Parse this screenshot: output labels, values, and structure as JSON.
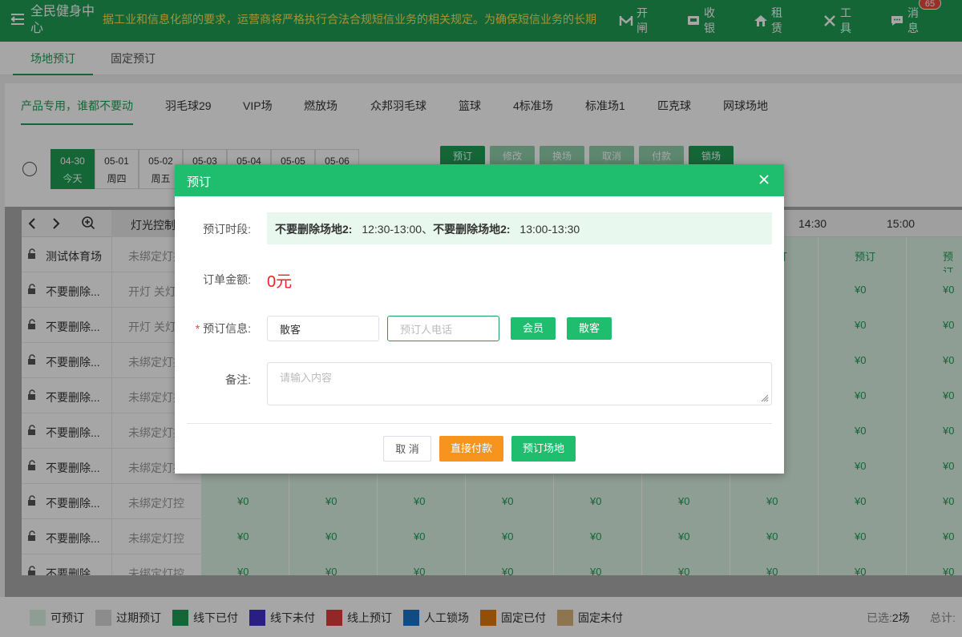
{
  "app": {
    "title": "全民健身中心",
    "notice": "据工业和信息化部的要求，运营商将严格执行合法合规短信业务的相关规定。为确保短信业务的长期"
  },
  "nav": [
    {
      "label": "开闸",
      "icon": "gate-icon"
    },
    {
      "label": "收银",
      "icon": "cashier-icon"
    },
    {
      "label": "租赁",
      "icon": "home-icon"
    },
    {
      "label": "工具",
      "icon": "tools-icon"
    },
    {
      "label": "消息",
      "icon": "message-icon",
      "badge": "65"
    }
  ],
  "main_tabs": [
    "场地预订",
    "固定预订"
  ],
  "venue_tabs": [
    "产品专用，谁都不要动",
    "羽毛球29",
    "VIP场",
    "燃放场",
    "众邦羽毛球",
    "篮球",
    "4标准场",
    "标准场1",
    "匹克球",
    "网球场地"
  ],
  "dates": [
    {
      "date": "04-30",
      "day": "今天"
    },
    {
      "date": "05-01",
      "day": "周四"
    },
    {
      "date": "05-02",
      "day": "周五"
    },
    {
      "date": "05-03",
      "day": ""
    },
    {
      "date": "05-04",
      "day": ""
    },
    {
      "date": "05-05",
      "day": ""
    },
    {
      "date": "05-06",
      "day": ""
    }
  ],
  "actions": [
    "预订",
    "修改",
    "换场",
    "取消",
    "付款",
    "锁场"
  ],
  "grid": {
    "light_header": "灯光控制",
    "times": [
      "14:30",
      "15:00"
    ],
    "book_label": "预订",
    "rows": [
      {
        "name": "测试体育场",
        "light": "未绑定灯控"
      },
      {
        "name": "不要删除...",
        "light": "开灯 关灯"
      },
      {
        "name": "不要删除...",
        "light": "开灯 关灯"
      },
      {
        "name": "不要删除...",
        "light": "未绑定灯控"
      },
      {
        "name": "不要删除...",
        "light": "未绑定灯控"
      },
      {
        "name": "不要删除...",
        "light": "未绑定灯控"
      },
      {
        "name": "不要删除...",
        "light": "未绑定灯控"
      },
      {
        "name": "不要删除...",
        "light": "未绑定灯控"
      },
      {
        "name": "不要删除...",
        "light": "未绑定灯控"
      },
      {
        "name": "不要删除",
        "light": "未绑定灯控"
      }
    ],
    "price": "¥0"
  },
  "legend": [
    {
      "label": "可预订",
      "color": "#daf3e5"
    },
    {
      "label": "过期预订",
      "color": "#d8d8d8"
    },
    {
      "label": "线下已付",
      "color": "#1f9d55"
    },
    {
      "label": "线下未付",
      "color": "#3f2fc8"
    },
    {
      "label": "线上预订",
      "color": "#e03c3c"
    },
    {
      "label": "人工锁场",
      "color": "#1a73c9"
    },
    {
      "label": "固定已付",
      "color": "#e07a10"
    },
    {
      "label": "固定未付",
      "color": "#d9b47a"
    }
  ],
  "summary": {
    "selected_label": "已选:",
    "selected_value": "2场",
    "total_label": "总计:"
  },
  "modal": {
    "title": "预订",
    "slot_label": "预订时段:",
    "slot_venue1": "不要删除场地2:",
    "slot_time1": "12:30-13:00、",
    "slot_venue2": "不要删除场地2:",
    "slot_time2": "13:00-13:30",
    "amount_label": "订单金额:",
    "amount": "0元",
    "info_label": "预订信息:",
    "info_required": "*",
    "name_value": "散客",
    "phone_placeholder": "预订人电话",
    "member_btn": "会员",
    "guest_btn": "散客",
    "remark_label": "备注:",
    "remark_placeholder": "请输入内容",
    "cancel": "取 消",
    "pay_now": "直接付款",
    "book": "预订场地"
  },
  "colors": {
    "brand": "#1f9d55",
    "modal_header": "#1ebe6e",
    "pay": "#f7941d",
    "amount": "#e22222"
  }
}
